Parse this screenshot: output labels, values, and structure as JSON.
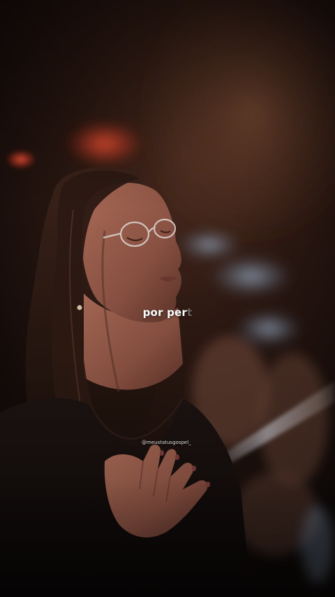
{
  "video": {
    "lyric_typed": "por per",
    "lyric_pending": "t",
    "watermark": "@meustatusgospel_"
  }
}
